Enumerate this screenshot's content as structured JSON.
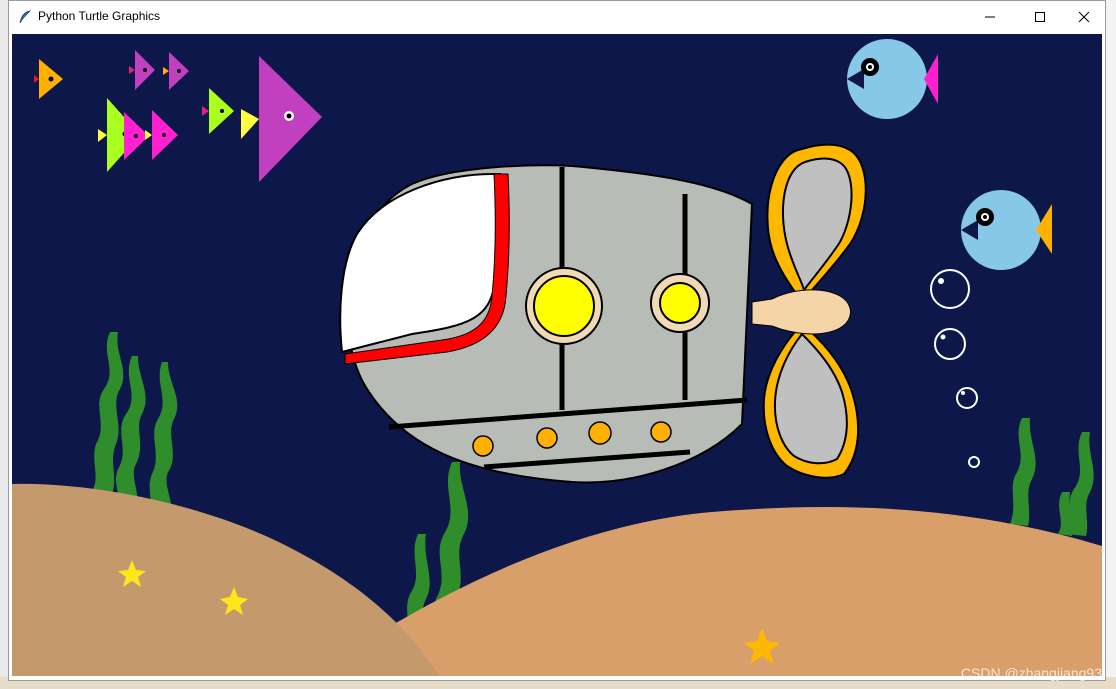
{
  "window": {
    "title": "Python Turtle Graphics",
    "minimize_icon": "minimize-icon",
    "maximize_icon": "maximize-icon",
    "close_icon": "close-icon"
  },
  "watermark": "CSDN @zhangjiang93",
  "colors": {
    "ocean": "#0e174a",
    "sand_left": "#c49a6c",
    "sand_right": "#d99f6b",
    "seaweed": "#2f8d2c",
    "sub_body": "#b8bcb6",
    "window_red": "#ff0000",
    "porthole_yellow": "#ffff00",
    "propeller_orange": "#ffb800",
    "propeller_blade": "#c0c0c0",
    "shaft": "#f5d5a8",
    "fish_blue": "#87c8e8",
    "star_yellow": "#ffe61a"
  }
}
